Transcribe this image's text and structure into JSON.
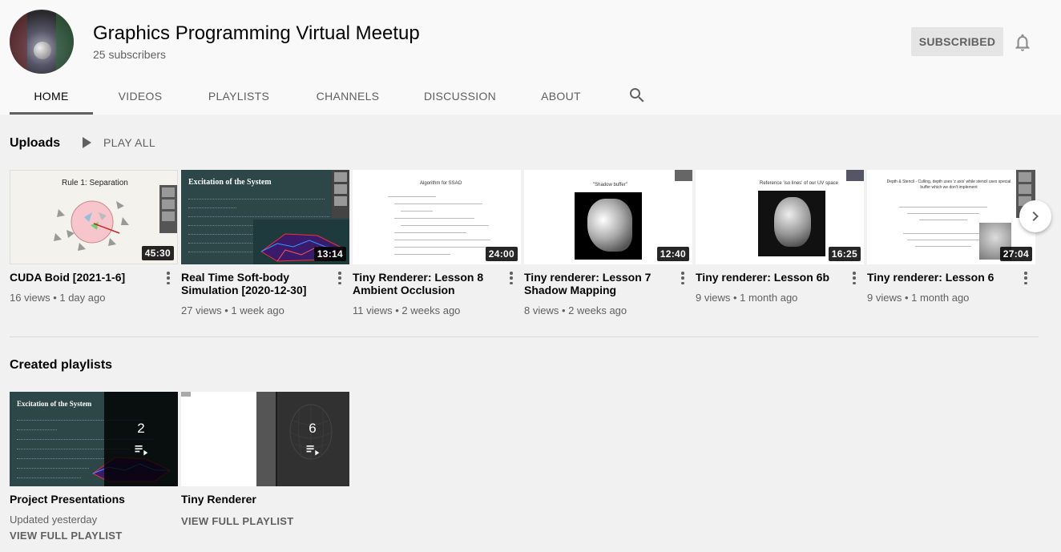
{
  "channel": {
    "title": "Graphics Programming Virtual Meetup",
    "subscribers": "25 subscribers",
    "subscribe_label": "SUBSCRIBED"
  },
  "tabs": [
    {
      "label": "HOME",
      "active": true
    },
    {
      "label": "VIDEOS"
    },
    {
      "label": "PLAYLISTS"
    },
    {
      "label": "CHANNELS"
    },
    {
      "label": "DISCUSSION"
    },
    {
      "label": "ABOUT"
    }
  ],
  "icons": {
    "search": "search-icon",
    "bell": "bell-icon",
    "play": "play-icon",
    "next": "chevron-right-icon",
    "more": "more-vert-icon",
    "playlist": "playlist-play-icon"
  },
  "uploads": {
    "title": "Uploads",
    "play_all": "PLAY ALL",
    "videos": [
      {
        "title": "CUDA Boid [2021-1-6]",
        "views": "16 views",
        "age": "1 day ago",
        "duration": "45:30",
        "thumb_text": "Rule 1: Separation"
      },
      {
        "title": "Real Time Soft-body Simulation [2020-12-30]",
        "views": "27 views",
        "age": "1 week ago",
        "duration": "13:14",
        "thumb_text": "Excitation of the System"
      },
      {
        "title": "Tiny Renderer: Lesson 8 Ambient Occlusion",
        "views": "11 views",
        "age": "2 weeks ago",
        "duration": "24:00",
        "thumb_text": "Algorithm for SSAO"
      },
      {
        "title": "Tiny renderer: Lesson 7 Shadow Mapping",
        "views": "8 views",
        "age": "2 weeks ago",
        "duration": "12:40",
        "thumb_text": "\"Shadow buffer\""
      },
      {
        "title": "Tiny renderer: Lesson 6b",
        "views": "9 views",
        "age": "1 month ago",
        "duration": "16:25",
        "thumb_text": "Reference 'iso lines' of our UV space"
      },
      {
        "title": "Tiny renderer: Lesson 6",
        "views": "9 views",
        "age": "1 month ago",
        "duration": "27:04",
        "thumb_text": "Depth & Stencil - Culling, depth uses 'z axis' while stencil uses special buffer which we don't implement"
      }
    ]
  },
  "playlists": {
    "title": "Created playlists",
    "items": [
      {
        "title": "Project Presentations",
        "count": "2",
        "updated": "Updated yesterday",
        "link": "VIEW FULL PLAYLIST",
        "thumb_text": "Excitation of the System"
      },
      {
        "title": "Tiny Renderer",
        "count": "6",
        "link": "VIEW FULL PLAYLIST"
      }
    ]
  },
  "colors": {
    "header_bg": "#f9f9f9",
    "page_bg": "#f1f1f1",
    "text_primary": "#030303",
    "text_secondary": "#606060"
  }
}
